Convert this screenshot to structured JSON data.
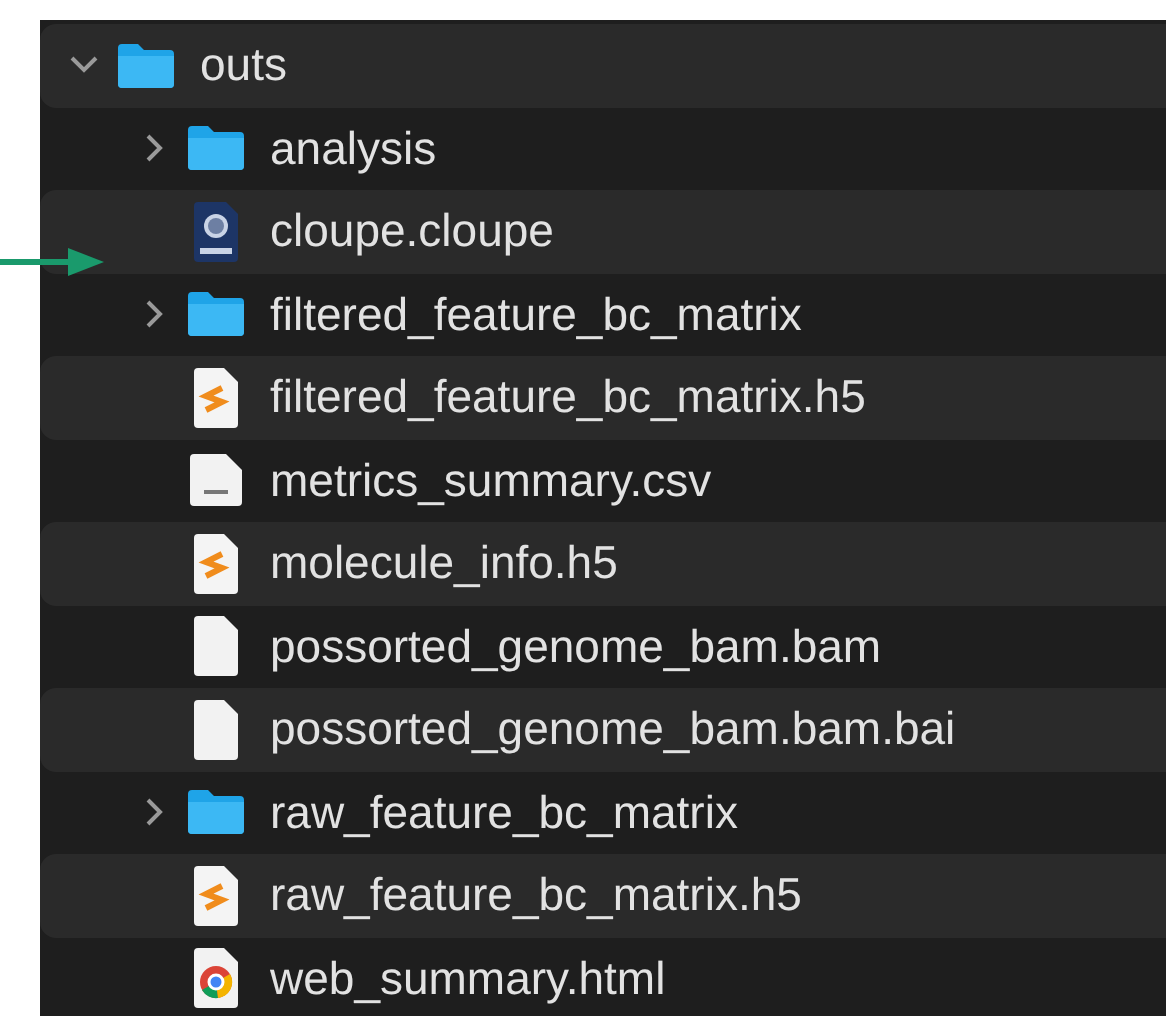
{
  "tree": [
    {
      "name": "outs",
      "kind": "folder",
      "expanded": true,
      "children": [
        {
          "name": "analysis",
          "kind": "folder",
          "expanded": false
        },
        {
          "name": "cloupe.cloupe",
          "kind": "loupe"
        },
        {
          "name": "filtered_feature_bc_matrix",
          "kind": "folder",
          "expanded": false
        },
        {
          "name": "filtered_feature_bc_matrix.h5",
          "kind": "code"
        },
        {
          "name": "metrics_summary.csv",
          "kind": "csv"
        },
        {
          "name": "molecule_info.h5",
          "kind": "code"
        },
        {
          "name": "possorted_genome_bam.bam",
          "kind": "blank"
        },
        {
          "name": "possorted_genome_bam.bam.bai",
          "kind": "blank"
        },
        {
          "name": "raw_feature_bc_matrix",
          "kind": "folder",
          "expanded": false
        },
        {
          "name": "raw_feature_bc_matrix.h5",
          "kind": "code"
        },
        {
          "name": "web_summary.html",
          "kind": "browser"
        }
      ]
    }
  ]
}
